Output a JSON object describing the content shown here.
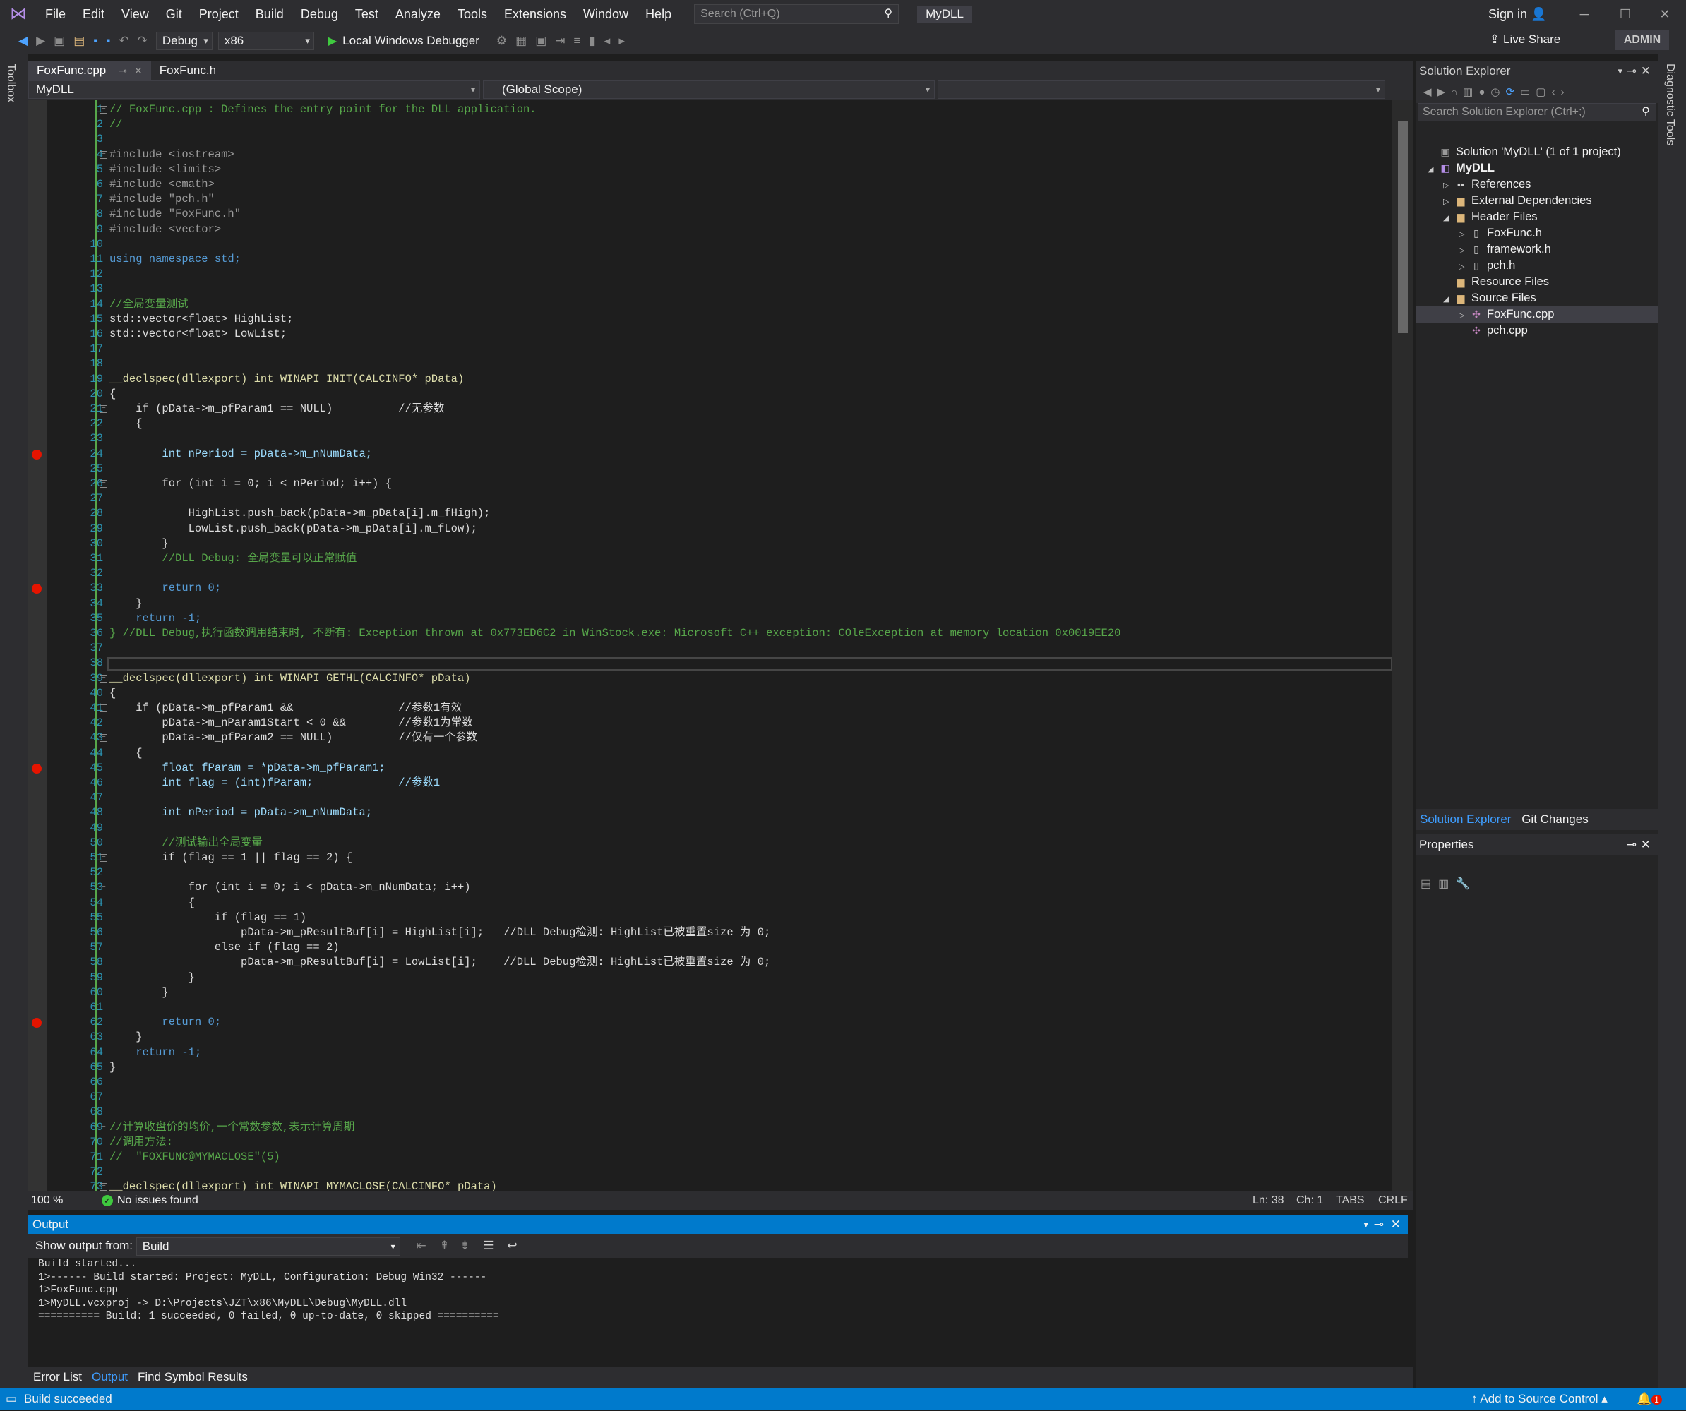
{
  "menu": {
    "items": [
      "File",
      "Edit",
      "View",
      "Git",
      "Project",
      "Build",
      "Debug",
      "Test",
      "Analyze",
      "Tools",
      "Extensions",
      "Window",
      "Help"
    ],
    "search_placeholder": "Search (Ctrl+Q)",
    "solution_name": "MyDLL",
    "sign_in": "Sign in"
  },
  "toolbar": {
    "config": "Debug",
    "platform": "x86",
    "debugger": "Local Windows Debugger",
    "live_share": "Live Share",
    "admin": "ADMIN"
  },
  "sidebar": {
    "toolbox": "Toolbox",
    "diagnostic_tools": "Diagnostic Tools"
  },
  "tabs": [
    {
      "label": "FoxFunc.cpp",
      "active": true
    },
    {
      "label": "FoxFunc.h",
      "active": false
    }
  ],
  "navbar": {
    "project": "MyDLL",
    "scope": "(Global Scope)"
  },
  "editor": {
    "lines": [
      {
        "n": "1",
        "t": "// FoxFunc.cpp : Defines the entry point for the DLL application.",
        "c": "cm",
        "fold": true
      },
      {
        "n": "2",
        "t": "//",
        "c": "cm"
      },
      {
        "n": "3",
        "t": "",
        "c": "pl"
      },
      {
        "n": "4",
        "t": "#include <iostream>",
        "c": "pp",
        "fold": true
      },
      {
        "n": "5",
        "t": "#include <limits>",
        "c": "pp"
      },
      {
        "n": "6",
        "t": "#include <cmath>",
        "c": "pp"
      },
      {
        "n": "7",
        "t": "#include \"pch.h\"",
        "c": "pp"
      },
      {
        "n": "8",
        "t": "#include \"FoxFunc.h\"",
        "c": "pp"
      },
      {
        "n": "9",
        "t": "#include <vector>",
        "c": "pp"
      },
      {
        "n": "10",
        "t": "",
        "c": "pl"
      },
      {
        "n": "11",
        "t": "using namespace std;",
        "c": "kw"
      },
      {
        "n": "12",
        "t": "",
        "c": "pl"
      },
      {
        "n": "13",
        "t": "",
        "c": "pl"
      },
      {
        "n": "14",
        "t": "//全局变量测试",
        "c": "cm"
      },
      {
        "n": "15",
        "t": "std::vector<float> HighList;",
        "c": "pl"
      },
      {
        "n": "16",
        "t": "std::vector<float> LowList;",
        "c": "pl"
      },
      {
        "n": "17",
        "t": "",
        "c": "pl"
      },
      {
        "n": "18",
        "t": "",
        "c": "pl"
      },
      {
        "n": "19",
        "t": "__declspec(dllexport) int WINAPI INIT(CALCINFO* pData)",
        "c": "fn",
        "fold": true
      },
      {
        "n": "20",
        "t": "{",
        "c": "pl"
      },
      {
        "n": "21",
        "t": "    if (pData->m_pfParam1 == NULL)          //无参数",
        "c": "pl",
        "fold": true
      },
      {
        "n": "22",
        "t": "    {",
        "c": "pl"
      },
      {
        "n": "23",
        "t": "",
        "c": "pl"
      },
      {
        "n": "24",
        "t": "        int nPeriod = pData->m_nNumData;",
        "c": "vr",
        "bp": true
      },
      {
        "n": "25",
        "t": "",
        "c": "pl"
      },
      {
        "n": "26",
        "t": "        for (int i = 0; i < nPeriod; i++) {",
        "c": "pl",
        "fold": true
      },
      {
        "n": "27",
        "t": "",
        "c": "pl"
      },
      {
        "n": "28",
        "t": "            HighList.push_back(pData->m_pData[i].m_fHigh);",
        "c": "pl"
      },
      {
        "n": "29",
        "t": "            LowList.push_back(pData->m_pData[i].m_fLow);",
        "c": "pl"
      },
      {
        "n": "30",
        "t": "        }",
        "c": "pl"
      },
      {
        "n": "31",
        "t": "        //DLL Debug: 全局变量可以正常赋值",
        "c": "cm"
      },
      {
        "n": "32",
        "t": "",
        "c": "pl"
      },
      {
        "n": "33",
        "t": "        return 0;",
        "c": "kw",
        "bp": true
      },
      {
        "n": "34",
        "t": "    }",
        "c": "pl"
      },
      {
        "n": "35",
        "t": "    return -1;",
        "c": "kw"
      },
      {
        "n": "36",
        "t": "} //DLL Debug,执行函数调用结束时, 不断有: Exception thrown at 0x773ED6C2 in WinStock.exe: Microsoft C++ exception: COleException at memory location 0x0019EE20",
        "c": "cm"
      },
      {
        "n": "37",
        "t": "",
        "c": "pl"
      },
      {
        "n": "38",
        "t": "",
        "c": "pl"
      },
      {
        "n": "39",
        "t": "__declspec(dllexport) int WINAPI GETHL(CALCINFO* pData)",
        "c": "fn",
        "fold": true
      },
      {
        "n": "40",
        "t": "{",
        "c": "pl"
      },
      {
        "n": "41",
        "t": "    if (pData->m_pfParam1 &&                //参数1有效",
        "c": "pl",
        "fold": true
      },
      {
        "n": "42",
        "t": "        pData->m_nParam1Start < 0 &&        //参数1为常数",
        "c": "pl"
      },
      {
        "n": "43",
        "t": "        pData->m_pfParam2 == NULL)          //仅有一个参数",
        "c": "pl",
        "fold": true
      },
      {
        "n": "44",
        "t": "    {",
        "c": "pl"
      },
      {
        "n": "45",
        "t": "        float fParam = *pData->m_pfParam1;",
        "c": "vr",
        "bp": true
      },
      {
        "n": "46",
        "t": "        int flag = (int)fParam;             //参数1",
        "c": "vr"
      },
      {
        "n": "47",
        "t": "",
        "c": "pl"
      },
      {
        "n": "48",
        "t": "        int nPeriod = pData->m_nNumData;",
        "c": "vr"
      },
      {
        "n": "49",
        "t": "",
        "c": "pl"
      },
      {
        "n": "50",
        "t": "        //测试输出全局变量",
        "c": "cm"
      },
      {
        "n": "51",
        "t": "        if (flag == 1 || flag == 2) {",
        "c": "pl",
        "fold": true
      },
      {
        "n": "52",
        "t": "",
        "c": "pl"
      },
      {
        "n": "53",
        "t": "            for (int i = 0; i < pData->m_nNumData; i++)",
        "c": "pl",
        "fold": true
      },
      {
        "n": "54",
        "t": "            {",
        "c": "pl"
      },
      {
        "n": "55",
        "t": "                if (flag == 1)",
        "c": "pl"
      },
      {
        "n": "56",
        "t": "                    pData->m_pResultBuf[i] = HighList[i];   //DLL Debug检测: HighList已被重置size 为 0;",
        "c": "pl"
      },
      {
        "n": "57",
        "t": "                else if (flag == 2)",
        "c": "pl"
      },
      {
        "n": "58",
        "t": "                    pData->m_pResultBuf[i] = LowList[i];    //DLL Debug检测: HighList已被重置size 为 0;",
        "c": "pl"
      },
      {
        "n": "59",
        "t": "            }",
        "c": "pl"
      },
      {
        "n": "60",
        "t": "        }",
        "c": "pl"
      },
      {
        "n": "61",
        "t": "",
        "c": "pl"
      },
      {
        "n": "62",
        "t": "        return 0;",
        "c": "kw",
        "bp": true
      },
      {
        "n": "63",
        "t": "    }",
        "c": "pl"
      },
      {
        "n": "64",
        "t": "    return -1;",
        "c": "kw"
      },
      {
        "n": "65",
        "t": "}",
        "c": "pl"
      },
      {
        "n": "66",
        "t": "",
        "c": "pl"
      },
      {
        "n": "67",
        "t": "",
        "c": "pl"
      },
      {
        "n": "68",
        "t": "",
        "c": "pl"
      },
      {
        "n": "69",
        "t": "//计算收盘价的均价,一个常数参数,表示计算周期",
        "c": "cm",
        "fold": true
      },
      {
        "n": "70",
        "t": "//调用方法:",
        "c": "cm"
      },
      {
        "n": "71",
        "t": "//  \"FOXFUNC@MYMACLOSE\"(5)",
        "c": "cm"
      },
      {
        "n": "72",
        "t": "",
        "c": "pl"
      },
      {
        "n": "73",
        "t": "__declspec(dllexport) int WINAPI MYMACLOSE(CALCINFO* pData)",
        "c": "fn",
        "fold": true
      }
    ]
  },
  "editor_status": {
    "zoom": "100 %",
    "issues": "No issues found",
    "ln": "Ln: 38",
    "ch": "Ch: 1",
    "tabs": "TABS",
    "eol": "CRLF"
  },
  "output": {
    "title": "Output",
    "show_from_label": "Show output from:",
    "source": "Build",
    "lines": [
      "Build started...",
      "1>------ Build started: Project: MyDLL, Configuration: Debug Win32 ------",
      "1>FoxFunc.cpp",
      "1>MyDLL.vcxproj -> D:\\Projects\\JZT\\x86\\MyDLL\\Debug\\MyDLL.dll",
      "========== Build: 1 succeeded, 0 failed, 0 up-to-date, 0 skipped =========="
    ]
  },
  "bottom_tabs": [
    "Error List",
    "Output",
    "Find Symbol Results"
  ],
  "solution_explorer": {
    "title": "Solution Explorer",
    "search_placeholder": "Search Solution Explorer (Ctrl+;)",
    "items": [
      {
        "label": "Solution 'MyDLL' (1 of 1 project)",
        "level": 0,
        "icon": "solution-icon",
        "arrow": ""
      },
      {
        "label": "MyDLL",
        "level": 0,
        "icon": "project-icon",
        "arrow": "◢",
        "bold": true
      },
      {
        "label": "References",
        "level": 1,
        "icon": "references-icon",
        "arrow": "▷"
      },
      {
        "label": "External Dependencies",
        "level": 1,
        "icon": "folder-icon",
        "arrow": "▷"
      },
      {
        "label": "Header Files",
        "level": 1,
        "icon": "folder-icon",
        "arrow": "◢"
      },
      {
        "label": "FoxFunc.h",
        "level": 2,
        "icon": "file-h-icon",
        "arrow": "▷"
      },
      {
        "label": "framework.h",
        "level": 2,
        "icon": "file-h-icon",
        "arrow": "▷"
      },
      {
        "label": "pch.h",
        "level": 2,
        "icon": "file-h-icon",
        "arrow": "▷"
      },
      {
        "label": "Resource Files",
        "level": 1,
        "icon": "folder-icon",
        "arrow": ""
      },
      {
        "label": "Source Files",
        "level": 1,
        "icon": "folder-icon",
        "arrow": "◢"
      },
      {
        "label": "FoxFunc.cpp",
        "level": 2,
        "icon": "file-cpp-icon",
        "arrow": "▷",
        "selected": true
      },
      {
        "label": "pch.cpp",
        "level": 2,
        "icon": "file-cpp-icon",
        "arrow": ""
      }
    ],
    "tabs": [
      "Solution Explorer",
      "Git Changes"
    ]
  },
  "properties": {
    "title": "Properties"
  },
  "statusbar": {
    "message": "Build succeeded",
    "source_control": "Add to Source Control",
    "notifications": "1"
  },
  "colors": {
    "accent": "#007acc",
    "breakpoint": "#e51400",
    "comment": "#57a64a",
    "keyword": "#569cd6"
  }
}
